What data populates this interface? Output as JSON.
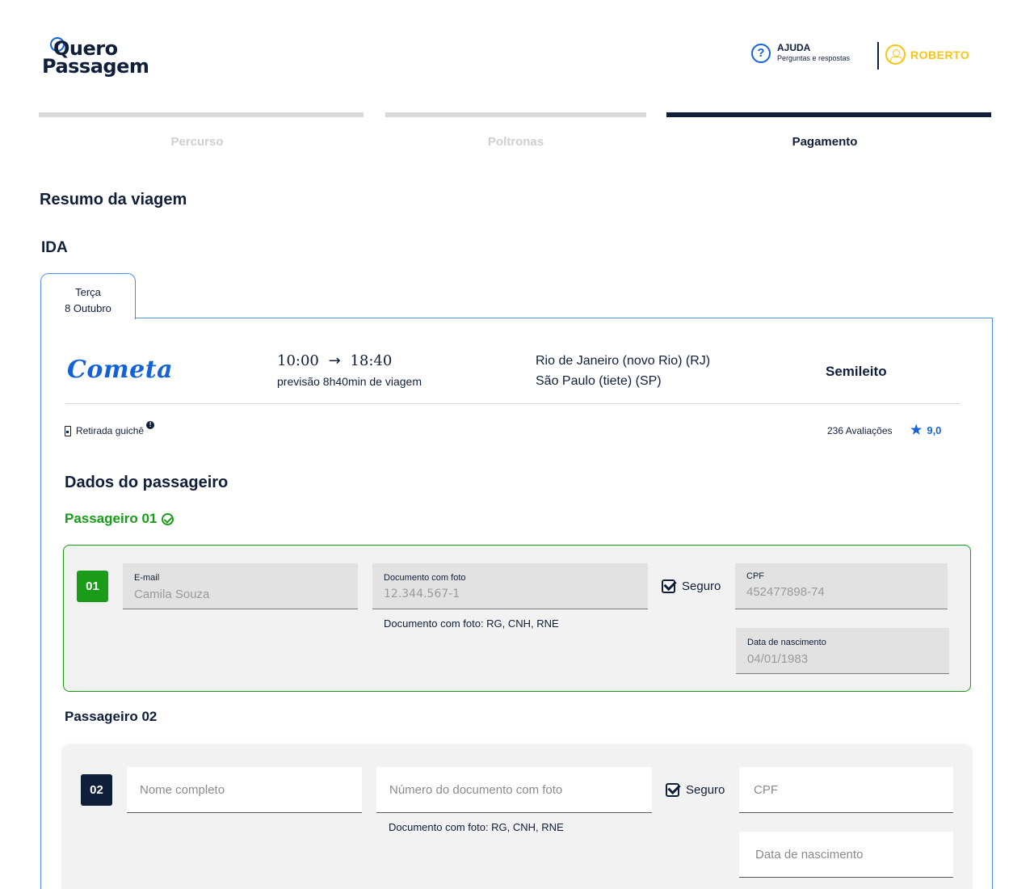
{
  "header": {
    "logo_top": "Quero",
    "logo_bottom": "Passagem",
    "help_title": "AJUDA",
    "help_subtitle": "Perguntas e respostas",
    "user_name": "ROBERTO"
  },
  "steps": [
    {
      "label": "Percurso",
      "state": "done"
    },
    {
      "label": "Poltronas",
      "state": "done"
    },
    {
      "label": "Pagamento",
      "state": "active"
    }
  ],
  "summary_title": "Resumo da viagem",
  "trip": {
    "direction": "IDA",
    "date_weekday": "Terça",
    "date_day": "8 Outubro",
    "company": "Cometa",
    "departure": "10:00",
    "arrival": "18:40",
    "duration": "previsão 8h40min de viagem",
    "origin": "Rio de Janeiro (novo Rio) (RJ)",
    "destination": "São Paulo (tiete) (SP)",
    "seat_class": "Semileito",
    "pickup": "Retirada guichê",
    "reviews": "236 Avaliações",
    "rating": "9,0"
  },
  "passenger_section_title": "Dados do passageiro",
  "passengers": [
    {
      "title": "Passageiro 01",
      "number": "01",
      "email_label": "E-mail",
      "email_value": "Camila Souza",
      "doc_label": "Documento com foto",
      "doc_value": "12.344.567-1",
      "doc_hint": "Documento com foto: RG, CNH, RNE",
      "insurance_label": "Seguro",
      "cpf_label": "CPF",
      "cpf_value": "452477898-74",
      "birth_label": "Data de nascimento",
      "birth_value": "04/01/1983"
    },
    {
      "title": "Passageiro 02",
      "number": "02",
      "name_placeholder": "Nome completo",
      "doc_placeholder": "Número do documento com foto",
      "doc_hint": "Documento com foto: RG, CNH, RNE",
      "insurance_label": "Seguro",
      "cpf_placeholder": "CPF",
      "birth_placeholder": "Data de nascimento"
    }
  ],
  "colors": {
    "navy": "#0f1f3a",
    "blue": "#1463d6",
    "green": "#1a9b1a",
    "yellow": "#f5c518",
    "step_inactive": "#d9d9d9"
  }
}
